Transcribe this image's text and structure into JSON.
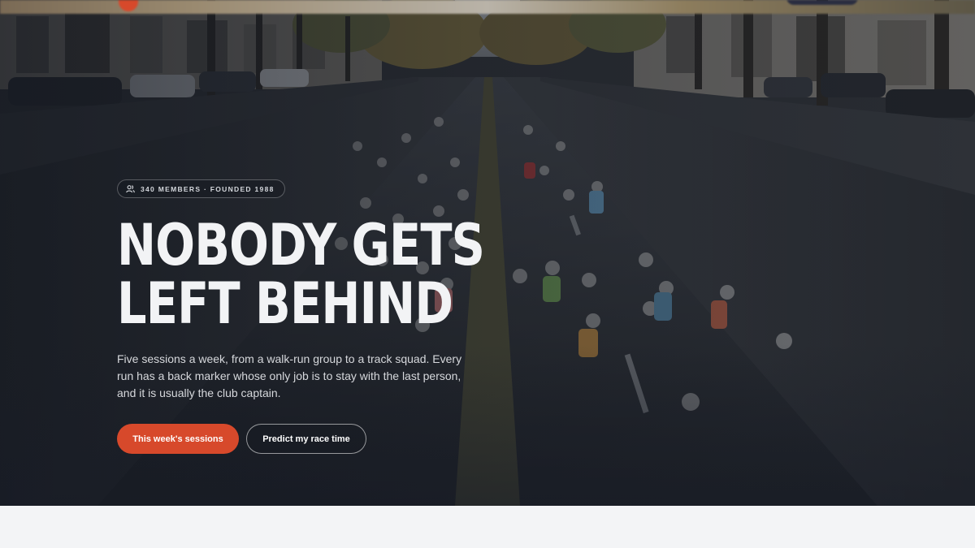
{
  "hero": {
    "badge": "340 MEMBERS · FOUNDED 1988",
    "badge_icon": "members-icon",
    "headline_line1": "NOBODY GETS",
    "headline_line2": "LEFT BEHIND",
    "lead": "Five sessions a week, from a walk-run group to a track squad. Every run has a back marker whose only job is to stay with the last person, and it is usually the club captain.",
    "primary_cta": "This week's sessions",
    "secondary_cta": "Predict my race time",
    "photo_icon": "marathon-photo"
  },
  "colors": {
    "accent": "#d7492b",
    "overlay": "#12161e",
    "page_bg": "#f3f4f6",
    "text_light": "#f2f3f5"
  }
}
